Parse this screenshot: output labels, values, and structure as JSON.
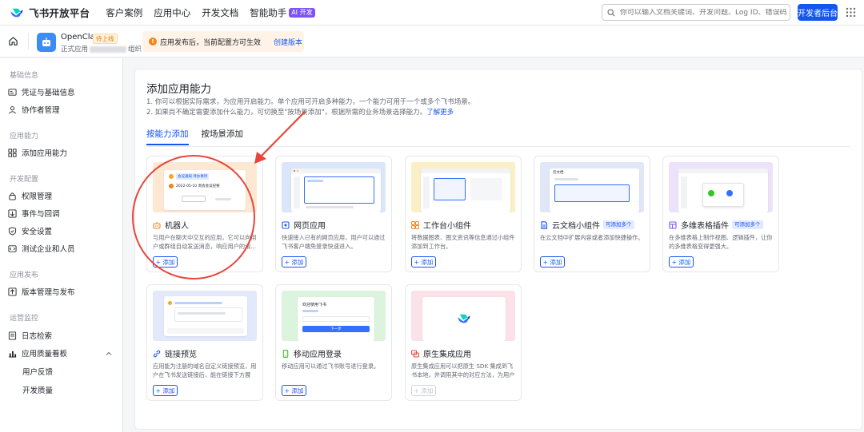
{
  "topbar": {
    "brand": "飞书开放平台",
    "nav": [
      "客户案例",
      "应用中心",
      "开发文档",
      "智能助手"
    ],
    "ai_badge": "AI 开发",
    "search_placeholder": "你可以输入文档关键词、开发问题、Log ID、错误码",
    "console_button": "开发者后台"
  },
  "app_header": {
    "app_name": "OpenClaw",
    "status_badge": "待上线",
    "sub_prefix": "正式应用",
    "sub_suffix": "组织",
    "notice_text": "应用发布后，当前配置方可生效",
    "notice_link": "创建版本"
  },
  "sidebar": {
    "sections": [
      {
        "title": "基础信息",
        "items": [
          "凭证与基础信息",
          "协作者管理"
        ]
      },
      {
        "title": "应用能力",
        "items": [
          "添加应用能力"
        ]
      },
      {
        "title": "开发配置",
        "items": [
          "权限管理",
          "事件与回调",
          "安全设置",
          "测试企业和人员"
        ]
      },
      {
        "title": "应用发布",
        "items": [
          "版本管理与发布"
        ]
      },
      {
        "title": "运营监控",
        "items": [
          "日志检索",
          "应用质量看板"
        ]
      }
    ],
    "subitems": [
      "用户反馈",
      "开发质量"
    ]
  },
  "main": {
    "title": "添加应用能力",
    "desc1": "1. 你可以根据实际需求，为应用开启能力。单个应用可开启多种能力，一个能力可用于一个或多个飞书场景。",
    "desc2": "2. 如果尚不确定需要添加什么能力，可切换至\"按场景添加\"，根据所需的业务场景选择能力。",
    "desc2_link": "了解更多",
    "tabs": [
      "按能力添加",
      "按场景添加"
    ],
    "add_label": "+ 添加",
    "cards": [
      {
        "title": "机器人",
        "desc": "与用户在聊天中交互的应用，它可以向用户或群组自动发送消息，响应用户的请..."
      },
      {
        "title": "网页应用",
        "desc": "快速接入已有的网页应用，用户可以通过飞书客户端免登录快速进入。"
      },
      {
        "title": "工作台小组件",
        "desc": "将数据图表、图文资讯等信息通过小组件添加到工作台。"
      },
      {
        "title": "云文档小组件",
        "tag": "可添加多个",
        "desc": "在云文档中扩展内容或者添加快捷操作。"
      },
      {
        "title": "多维表格插件",
        "tag": "可添加多个",
        "desc": "在多维表格上制作视图、逻辑插件，让你的多维表格变得更强大。"
      },
      {
        "title": "链接预览",
        "desc": "应用能为注册的域名自定义链接预览，用户在飞书发送链接后，能在链接下方展示..."
      },
      {
        "title": "移动应用登录",
        "desc": "移动应用可以通过飞书账号进行登录。"
      },
      {
        "title": "原生集成应用",
        "desc": "原生集成应用可以把原生 SDK 集成到飞书本地，并调用其中的对应方法，为用户提..."
      }
    ],
    "thumb_texts": {
      "bot_chip": "会议通知  待办事项",
      "bot_line": "2022-05-10 周会会议纪要",
      "mobile_title": "欢迎使用飞书",
      "mobile_button": "下一步",
      "doc_title": "云文档"
    }
  },
  "colors": {
    "primary": "#1456f0",
    "annotation": "#e8453c",
    "warning": "#f5841a"
  }
}
